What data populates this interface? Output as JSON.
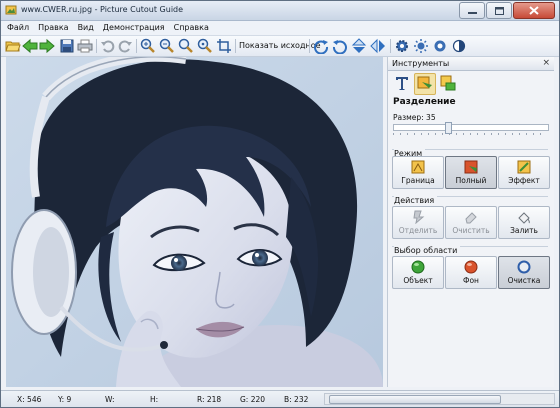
{
  "window": {
    "title": "www.CWER.ru.jpg - Picture Cutout Guide"
  },
  "menu": [
    "Файл",
    "Правка",
    "Вид",
    "Демонстрация",
    "Справка"
  ],
  "toolbar": {
    "show_original_label": "Показать исходное"
  },
  "panel": {
    "title": "Инструменты",
    "close_glyph": "×",
    "section_title": "Разделение",
    "size_label": "Размер: 35",
    "size_value": 35,
    "mode": {
      "title": "Режим",
      "buttons": [
        "Граница",
        "Полный",
        "Эффект"
      ]
    },
    "actions": {
      "title": "Действия",
      "buttons": [
        "Отделить",
        "Очистить",
        "Залить"
      ]
    },
    "area": {
      "title": "Выбор области",
      "buttons": [
        "Объект",
        "Фон",
        "Очистка"
      ]
    }
  },
  "status": {
    "x": "X: 546",
    "y": "Y: 9",
    "w": "W:",
    "h": "H:",
    "r": "R: 218",
    "g": "G: 220",
    "b": "B: 232"
  },
  "colors": {
    "accent": "#3c7fd0",
    "green": "#3fa53a",
    "red": "#d9532c",
    "blue_ring": "#2f5ea9",
    "selected_tab": "#f3e3a8"
  }
}
